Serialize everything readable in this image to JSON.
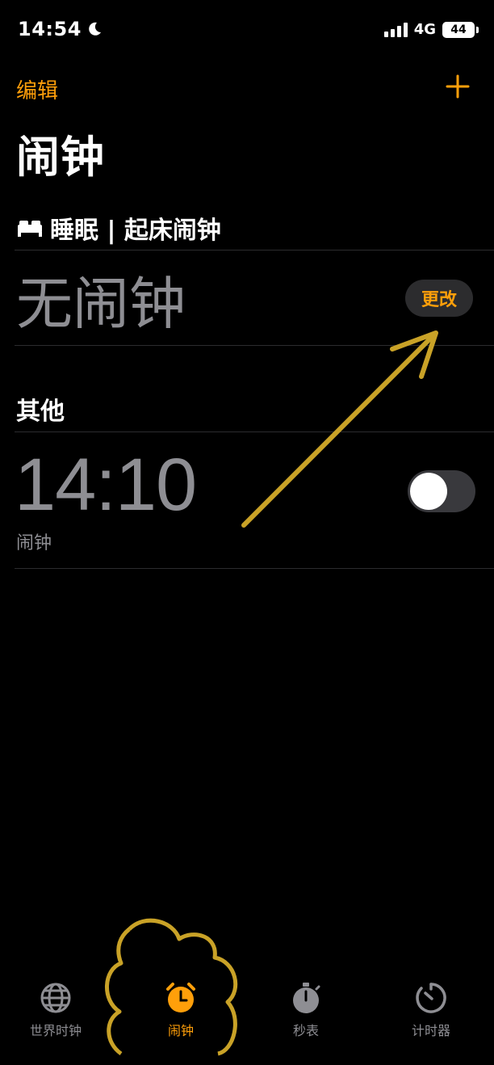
{
  "status_bar": {
    "time": "14:54",
    "network": "4G",
    "battery": "44",
    "icons": [
      "moon-icon",
      "signal-icon",
      "battery-icon"
    ]
  },
  "nav": {
    "edit_label": "编辑",
    "add_icon": "plus-icon"
  },
  "page_title": "闹钟",
  "sleep_section": {
    "icon": "bed-icon",
    "title": "睡眠 | 起床闹钟",
    "status": "无闹钟",
    "change_label": "更改"
  },
  "other_section": {
    "title": "其他",
    "alarms": [
      {
        "time": "14:10",
        "label": "闹钟",
        "enabled": false
      }
    ]
  },
  "tab_bar": {
    "tabs": [
      {
        "label": "世界时钟",
        "icon": "globe-icon",
        "active": false
      },
      {
        "label": "闹钟",
        "icon": "alarm-clock-icon",
        "active": true
      },
      {
        "label": "秒表",
        "icon": "stopwatch-icon",
        "active": false
      },
      {
        "label": "计时器",
        "icon": "timer-icon",
        "active": false
      }
    ]
  },
  "colors": {
    "accent": "#ff9f0a",
    "background": "#000000",
    "secondary_text": "#8e8e93",
    "annotation": "#c9a227"
  }
}
